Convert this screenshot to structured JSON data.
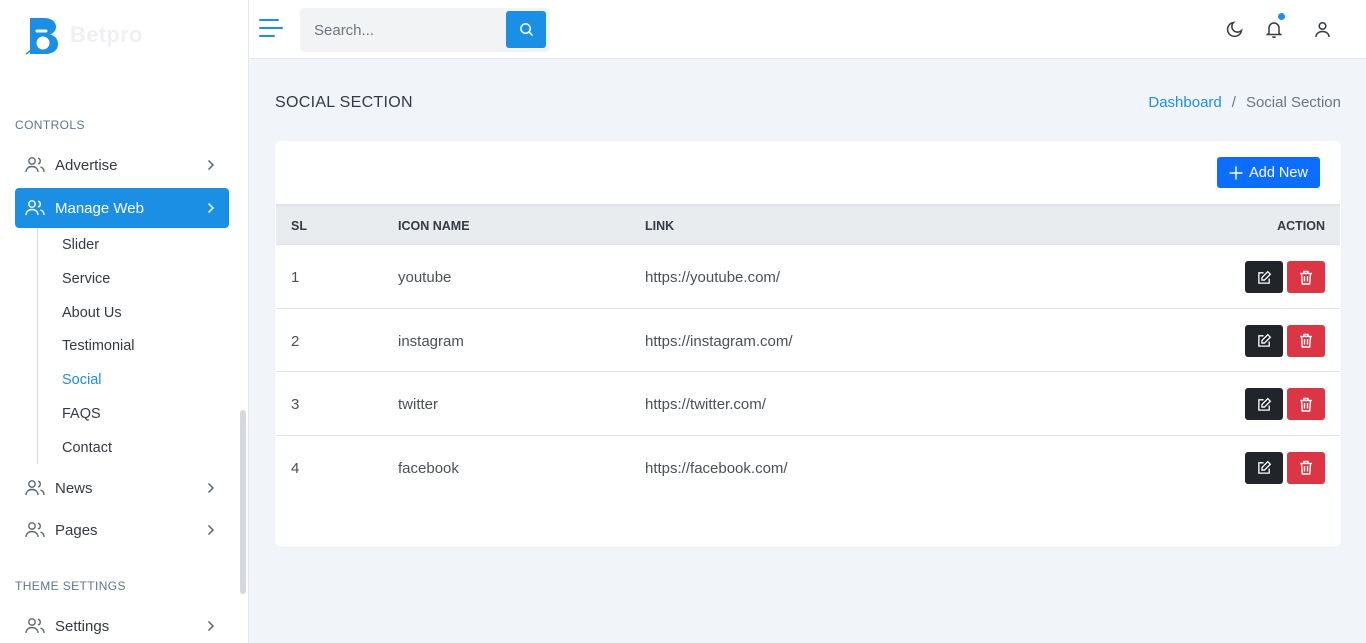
{
  "brand": {
    "name": "Betpro",
    "accent": "#1b8fe3"
  },
  "sidebar": {
    "sections": [
      {
        "title": "CONTROLS"
      },
      {
        "title": "THEME SETTINGS"
      }
    ],
    "items": [
      {
        "label": "Advertise",
        "icon": "users-icon"
      },
      {
        "label": "Manage Web",
        "icon": "users-icon",
        "active": true
      },
      {
        "label": "News",
        "icon": "users-icon"
      },
      {
        "label": "Pages",
        "icon": "users-icon"
      },
      {
        "label": "Settings",
        "icon": "users-icon"
      }
    ],
    "submenu": [
      {
        "label": "Slider"
      },
      {
        "label": "Service"
      },
      {
        "label": "About Us"
      },
      {
        "label": "Testimonial"
      },
      {
        "label": "Social",
        "current": true
      },
      {
        "label": "FAQS"
      },
      {
        "label": "Contact"
      }
    ]
  },
  "topbar": {
    "search_placeholder": "Search...",
    "icons": [
      "menu-icon",
      "search-icon",
      "moon-icon",
      "bell-icon",
      "user-icon"
    ]
  },
  "page": {
    "title": "SOCIAL SECTION",
    "breadcrumb": {
      "link": "Dashboard",
      "separator": "/",
      "current": "Social Section"
    }
  },
  "card": {
    "add_label": "Add New",
    "columns": {
      "sl": "SL",
      "icon_name": "ICON NAME",
      "link": "LINK",
      "action": "ACTION"
    },
    "rows": [
      {
        "sl": "1",
        "icon_name": "youtube",
        "link": "https://youtube.com/"
      },
      {
        "sl": "2",
        "icon_name": "instagram",
        "link": "https://instagram.com/"
      },
      {
        "sl": "3",
        "icon_name": "twitter",
        "link": "https://twitter.com/"
      },
      {
        "sl": "4",
        "icon_name": "facebook",
        "link": "https://facebook.com/"
      }
    ]
  }
}
